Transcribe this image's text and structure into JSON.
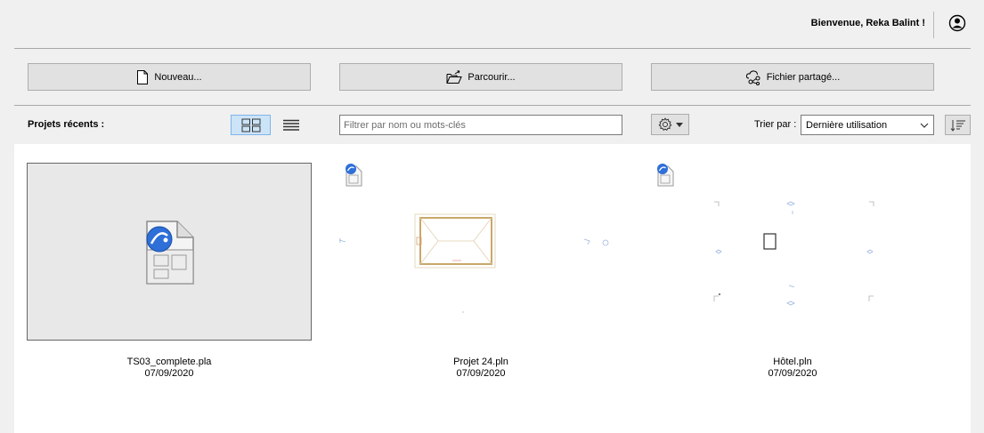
{
  "header": {
    "welcome_text": "Bienvenue, Reka Balint !",
    "user_icon": "user-circle-icon"
  },
  "actions": {
    "new_label": "Nouveau...",
    "browse_label": "Parcourir...",
    "shared_label": "Fichier partagé..."
  },
  "toolbar": {
    "recent_label": "Projets récents :",
    "filter_placeholder": "Filtrer par nom ou mots-clés",
    "sort_label": "Trier par :",
    "sort_value": "Dernière utilisation",
    "view_mode": "grid"
  },
  "projects": [
    {
      "name": "TS03_complete.pla",
      "date": "07/09/2020",
      "selected": true
    },
    {
      "name": "Projet 24.pln",
      "date": "07/09/2020",
      "selected": false
    },
    {
      "name": "Hôtel.pln",
      "date": "07/09/2020",
      "selected": false
    }
  ],
  "colors": {
    "accent": "#2e6fd8",
    "background": "#f0f0f0",
    "button": "#e1e1e1",
    "selected_toggle": "#cce4f7"
  }
}
